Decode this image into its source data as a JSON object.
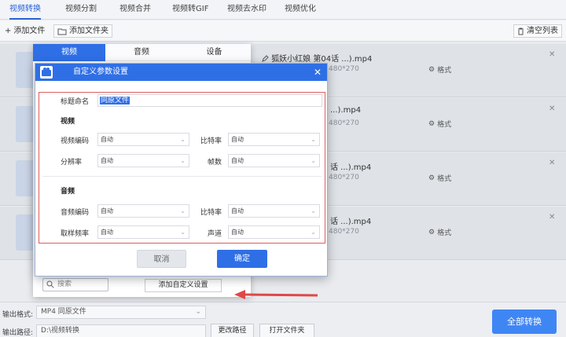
{
  "tabs": [
    "视频转换",
    "视频分割",
    "视频合并",
    "视频转GIF",
    "视频去水印",
    "视频优化"
  ],
  "toolbar": {
    "add_file": "添加文件",
    "add_folder": "添加文件夹",
    "clear_list": "清空列表"
  },
  "files": [
    {
      "name": "狐妖小红娘 第04话 ...).mp4",
      "meta": "480*270",
      "format_label": "格式"
    },
    {
      "name": "...).mp4",
      "meta": "480*270",
      "format_label": "格式"
    },
    {
      "name": "话 ...).mp4",
      "meta": "480*270",
      "format_label": "格式"
    },
    {
      "name": "话 ...).mp4",
      "meta": "480*270",
      "format_label": "格式"
    }
  ],
  "format_panel": {
    "tabs": [
      "视频",
      "音频",
      "设备"
    ],
    "search_placeholder": "搜索",
    "add_custom_label": "添加自定义设置"
  },
  "dialog": {
    "title": "自定义参数设置",
    "title_label": "标题命名",
    "title_value": "同原文件",
    "video_section": "视频",
    "audio_section": "音频",
    "video_codec_label": "视频编码",
    "video_codec_value": "自动",
    "video_bitrate_label": "比特率",
    "video_bitrate_value": "自动",
    "resolution_label": "分辨率",
    "resolution_value": "自动",
    "fps_label": "帧数",
    "fps_value": "自动",
    "audio_codec_label": "音频编码",
    "audio_codec_value": "自动",
    "audio_bitrate_label": "比特率",
    "audio_bitrate_value": "自动",
    "sample_rate_label": "取样频率",
    "sample_rate_value": "自动",
    "channel_label": "声道",
    "channel_value": "自动",
    "cancel_label": "取消",
    "ok_label": "确定"
  },
  "bottom": {
    "output_format_label": "输出格式:",
    "output_format_value": "MP4  同原文件",
    "output_path_label": "输出路径:",
    "output_path_value": "D:\\视频转换",
    "change_path_label": "更改路径",
    "open_folder_label": "打开文件夹",
    "convert_all_label": "全部转换"
  },
  "colors": {
    "accent": "#2f6fe6",
    "annotation": "#e04848"
  }
}
